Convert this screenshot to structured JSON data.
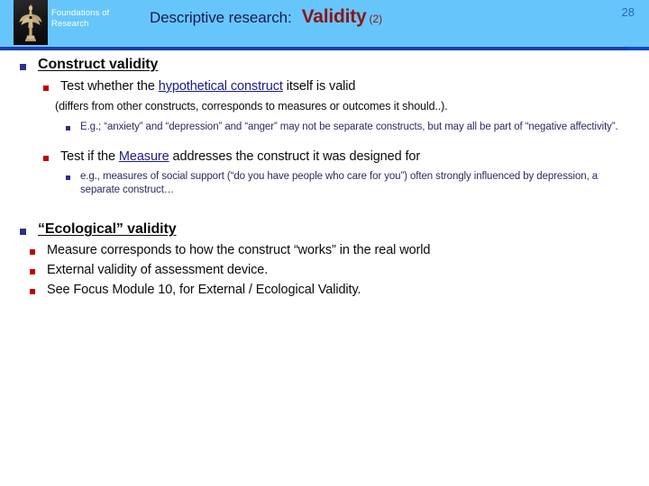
{
  "header": {
    "brand_line1": "Foundations of",
    "brand_line2": "Research",
    "logo_icon": "statue-logo-icon",
    "title_main": "Descriptive research:",
    "title_accent": "Validity",
    "title_sub": "(2)",
    "page_number": "28",
    "colors": {
      "band": "#66c6fb",
      "rule": "#1c3fa8",
      "accent_red": "#8e1318",
      "page_number": "#2b64c4"
    }
  },
  "content": {
    "sections": [
      {
        "heading": "Construct validity",
        "items": [
          {
            "text_before": "Test whether the ",
            "link": "hypothetical construct",
            "text_after": " itself is valid"
          },
          {
            "text_before": "Test if the ",
            "link": "Measure",
            "text_after": " addresses the construct it was designed for"
          }
        ],
        "paragraph": "(differs from other constructs, corresponds to measures or outcomes it should..).",
        "example_1": "E.g.; “anxiety” and “depression” and “anger” may not be separate constructs, but may all be part of “negative affectivity”.",
        "example_2": "e.g., measures of social support (“do you have people who care for you”) often strongly influenced by depression, a separate construct…"
      },
      {
        "heading": "“Ecological” validity",
        "bullets": [
          "Measure corresponds to how the construct “works” in the real world",
          "External validity of assessment device.",
          "See Focus Module 10, for External / Ecological Validity."
        ]
      }
    ]
  },
  "colors": {
    "bullet_level1": "#2e2e8f",
    "bullet_level2": "#c00000",
    "bullet_level3": "#2e2e8f",
    "link": "#1b1b8c",
    "body_text": "#0b0b0b",
    "example_text": "#2b2b5e"
  }
}
